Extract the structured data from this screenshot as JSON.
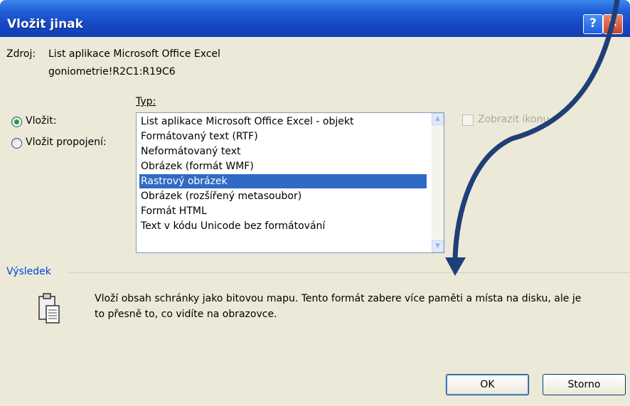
{
  "dialog": {
    "title": "Vložit jinak",
    "help_glyph": "?",
    "close_glyph": "✕"
  },
  "source": {
    "label": "Zdroj:",
    "line1": "List aplikace Microsoft Office Excel",
    "line2": "goniometrie!R2C1:R19C6"
  },
  "options": {
    "paste_label": "Vložit:",
    "paste_link_label": "Vložit propojení:",
    "selected": "paste"
  },
  "type": {
    "label": "Typ:",
    "items": [
      "List aplikace Microsoft Office Excel - objekt",
      "Formátovaný text (RTF)",
      "Neformátovaný text",
      "Obrázek (formát WMF)",
      "Rastrový obrázek",
      "Obrázek (rozšířený metasoubor)",
      "Formát HTML",
      "Text v kódu Unicode bez formátování"
    ],
    "selected_index": 4
  },
  "display_icon": {
    "label": "Zobrazit ikonu",
    "checked": false
  },
  "result": {
    "heading": "Výsledek",
    "line1": "Vloží obsah schránky jako bitovou mapu. Tento formát zabere více paměti a místa na disku, ale je",
    "line2": "to přesně to, co vidíte na obrazovce."
  },
  "buttons": {
    "ok": "OK",
    "cancel": "Storno"
  },
  "colors": {
    "titlebar": "#1f5fd6",
    "selection": "#316ac5",
    "arrow": "#1e3f78",
    "dialog_bg": "#ece9d8"
  },
  "icons": {
    "paste": "clipboard-icon",
    "scroll_up": "scroll-up-icon",
    "scroll_down": "scroll-down-icon",
    "close": "close-icon",
    "help": "help-icon"
  }
}
